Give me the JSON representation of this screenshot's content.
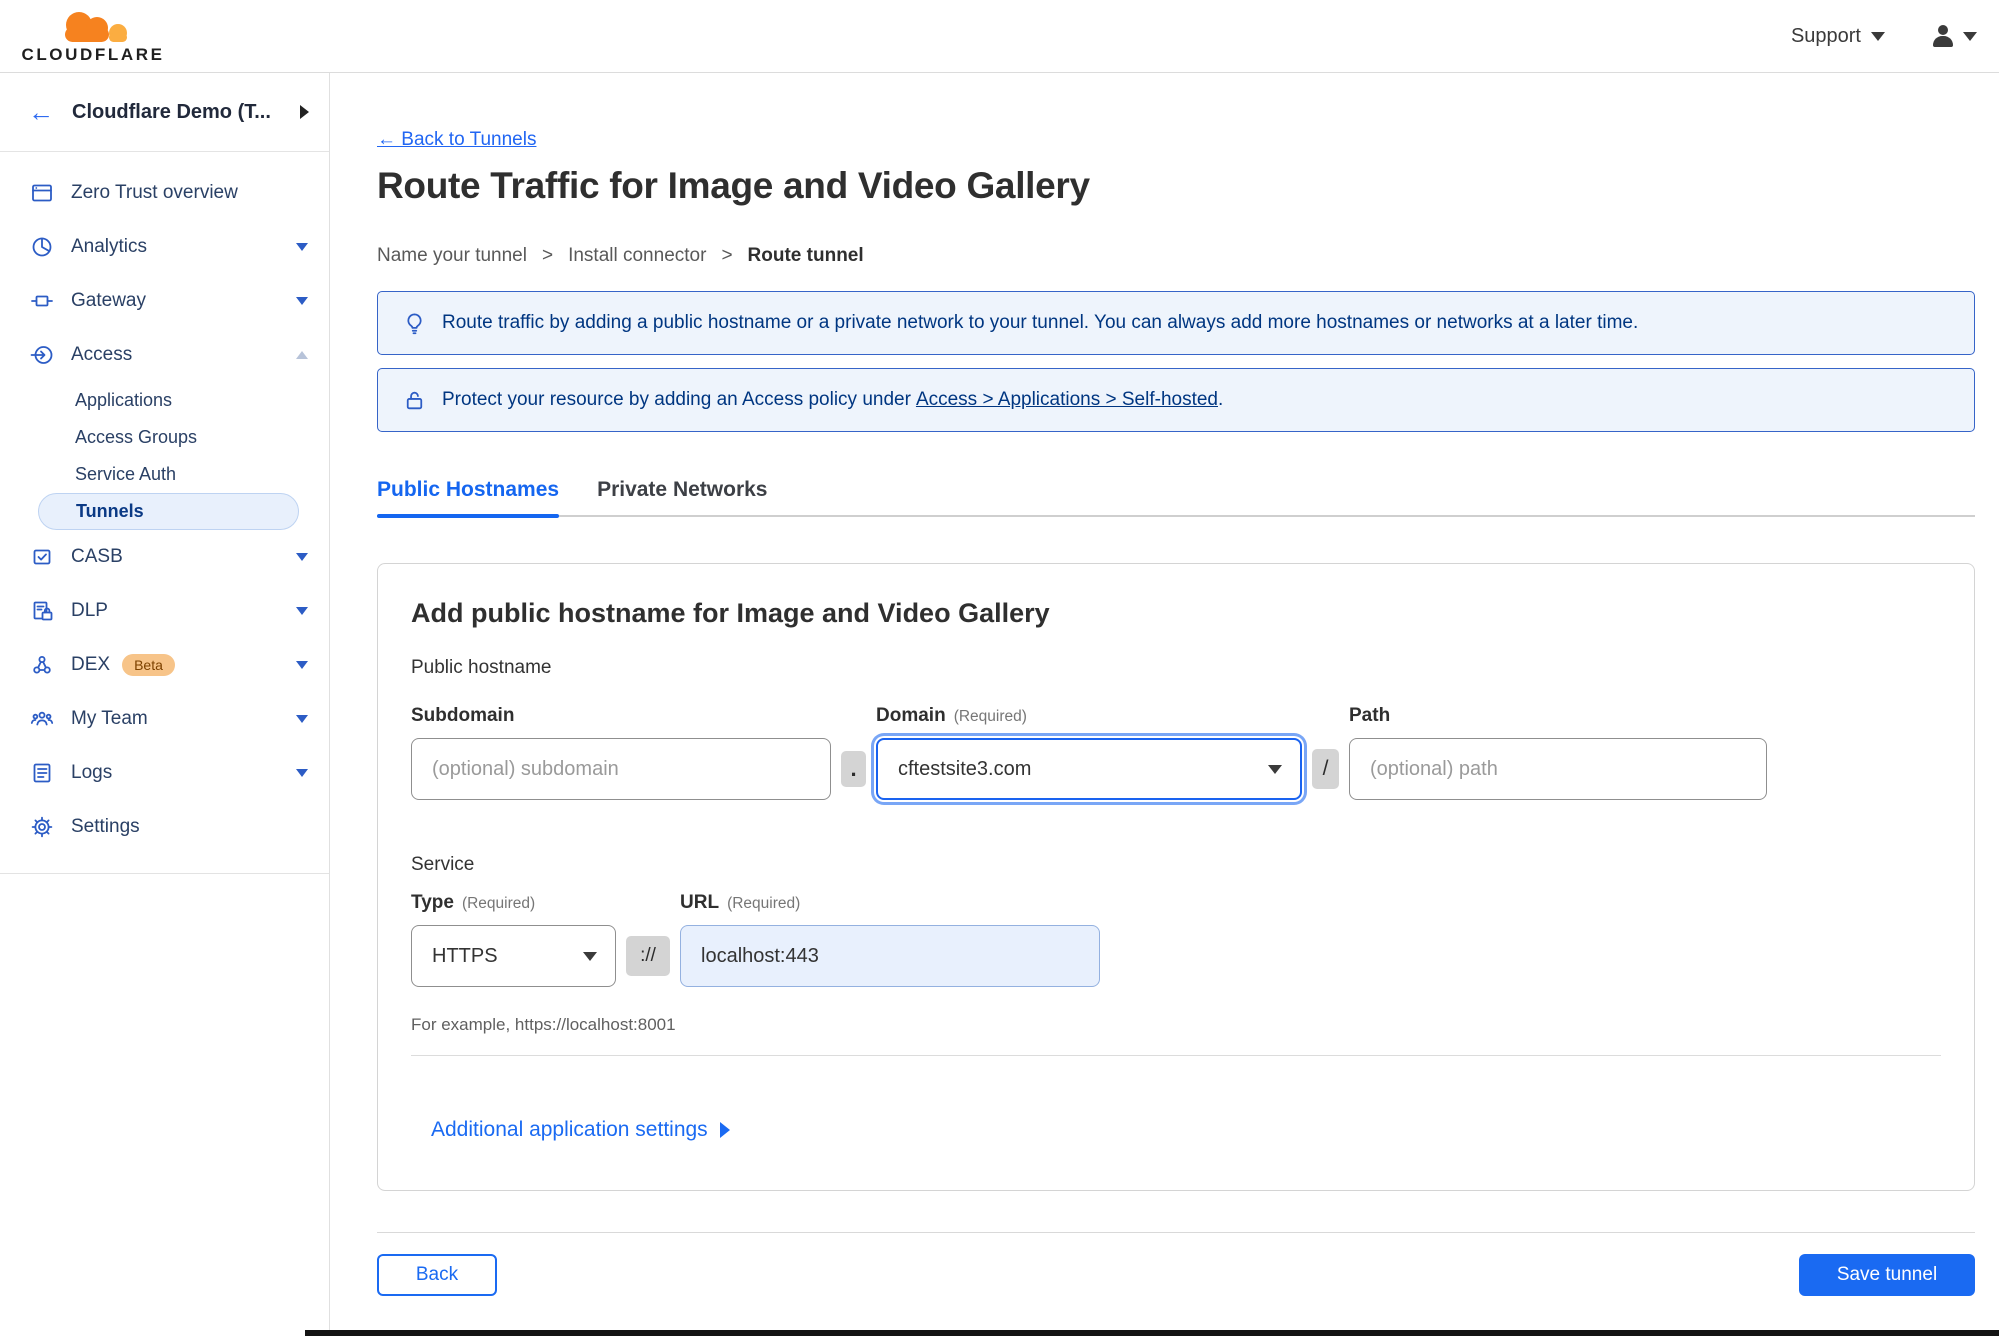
{
  "colors": {
    "accent_blue": "#1a6af2",
    "sidebar_icon_blue": "#2c5cc5",
    "banner_text_navy": "#003681",
    "banner_bg": "#eef4fc",
    "banner_border": "#3664c8",
    "selected_item_bg": "#e8f0fc",
    "beta_badge_bg": "#f7c489",
    "url_input_bg": "#e8f0fd",
    "logo_orange": "#f6821f",
    "logo_light_orange": "#fbad41"
  },
  "topbar": {
    "logo_text": "CLOUDFLARE",
    "support_label": "Support"
  },
  "sidebar": {
    "account_name": "Cloudflare Demo (T...",
    "items": [
      {
        "label": "Zero Trust overview"
      },
      {
        "label": "Analytics"
      },
      {
        "label": "Gateway"
      },
      {
        "label": "Access"
      },
      {
        "label": "CASB"
      },
      {
        "label": "DLP"
      },
      {
        "label": "DEX",
        "badge": "Beta"
      },
      {
        "label": "My Team"
      },
      {
        "label": "Logs"
      },
      {
        "label": "Settings"
      }
    ],
    "access_children": [
      {
        "label": "Applications"
      },
      {
        "label": "Access Groups"
      },
      {
        "label": "Service Auth"
      },
      {
        "label": "Tunnels",
        "selected": true
      }
    ]
  },
  "page": {
    "back_link": "← Back to Tunnels",
    "title": "Route Traffic for Image and Video Gallery",
    "steps": {
      "step1": "Name your tunnel",
      "sep": ">",
      "step2": "Install connector",
      "step3": "Route tunnel"
    },
    "banner_tip": "Route traffic by adding a public hostname or a private network to your tunnel. You can always add more hostnames or networks at a later time.",
    "banner_lock_prefix": "Protect your resource by adding an Access policy under",
    "banner_lock_link": "Access > Applications > Self-hosted",
    "banner_lock_suffix": ".",
    "tabs": {
      "public": "Public Hostnames",
      "private": "Private Networks"
    },
    "card": {
      "heading": "Add public hostname for Image and Video Gallery",
      "public_hostname_label": "Public hostname",
      "subdomain_label": "Subdomain",
      "subdomain_placeholder": "(optional) subdomain",
      "dot": ".",
      "domain_label": "Domain",
      "required": "(Required)",
      "domain_value": "cftestsite3.com",
      "slash": "/",
      "path_label": "Path",
      "path_placeholder": "(optional) path",
      "service_label": "Service",
      "type_label": "Type",
      "type_value": "HTTPS",
      "scheme": "://",
      "url_label": "URL",
      "url_value": "localhost:443",
      "example": "For example, https://localhost:8001",
      "additional_settings": "Additional application settings"
    },
    "footer": {
      "back": "Back",
      "save": "Save tunnel"
    }
  }
}
